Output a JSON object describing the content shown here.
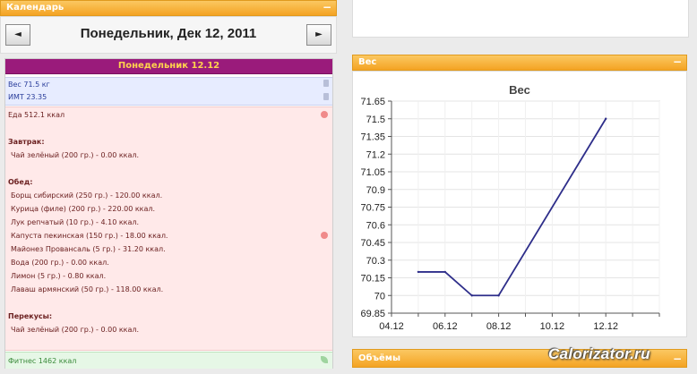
{
  "calendar": {
    "header": "Календарь",
    "minimize": "−",
    "prev": "◄",
    "next": "►",
    "date_title": "Понедельник, Дек 12, 2011"
  },
  "day": {
    "header": "Понедельник 12.12",
    "weight": "Вес 71.5 кг",
    "bmi": "ИМТ 23.35",
    "food_total": "Еда 512.1 ккал",
    "breakfast_title": "Завтрак:",
    "breakfast": [
      "Чай зелёный (200 гр.) - 0.00 ккал."
    ],
    "lunch_title": "Обед:",
    "lunch": [
      "Борщ сибирский (250 гр.) - 120.00 ккал.",
      "Курица (филе) (200 гр.) - 220.00 ккал.",
      "Лук репчатый (10 гр.) - 4.10 ккал.",
      "Капуста пекинская (150 гр.) - 18.00 ккал.",
      "Майонез Провансаль (5 гр.) - 31.20 ккал.",
      "Вода (200 гр.) - 0.00 ккал.",
      "Лимон (5 гр.) - 0.80 ккал.",
      "Лаваш армянский (50 гр.) - 118.00 ккал."
    ],
    "snacks_title": "Перекусы:",
    "snacks": [
      "Чай зелёный (200 гр.) - 0.00 ккал."
    ],
    "fitness": "Фитнес 1462 ккал"
  },
  "weight_panel": {
    "header": "Вес",
    "minimize": "−"
  },
  "volumes_panel": {
    "header": "Объёмы",
    "minimize": "−"
  },
  "watermark": "Calorizator.ru",
  "chart_data": {
    "type": "line",
    "title": "Вес",
    "x_ticks": [
      "04.12",
      "06.12",
      "08.12",
      "10.12",
      "12.12"
    ],
    "y_ticks": [
      "69.85",
      "70",
      "70.15",
      "70.3",
      "70.45",
      "70.6",
      "70.75",
      "70.9",
      "71.05",
      "71.2",
      "71.35",
      "71.5",
      "71.65"
    ],
    "ylim": [
      69.85,
      71.65
    ],
    "xlim": [
      4,
      14
    ],
    "series": [
      {
        "x": [
          5,
          6,
          7,
          8,
          12
        ],
        "y": [
          70.2,
          70.2,
          70.0,
          70.0,
          71.5
        ]
      }
    ],
    "line_color": "#2e2e8a",
    "grid": true
  }
}
